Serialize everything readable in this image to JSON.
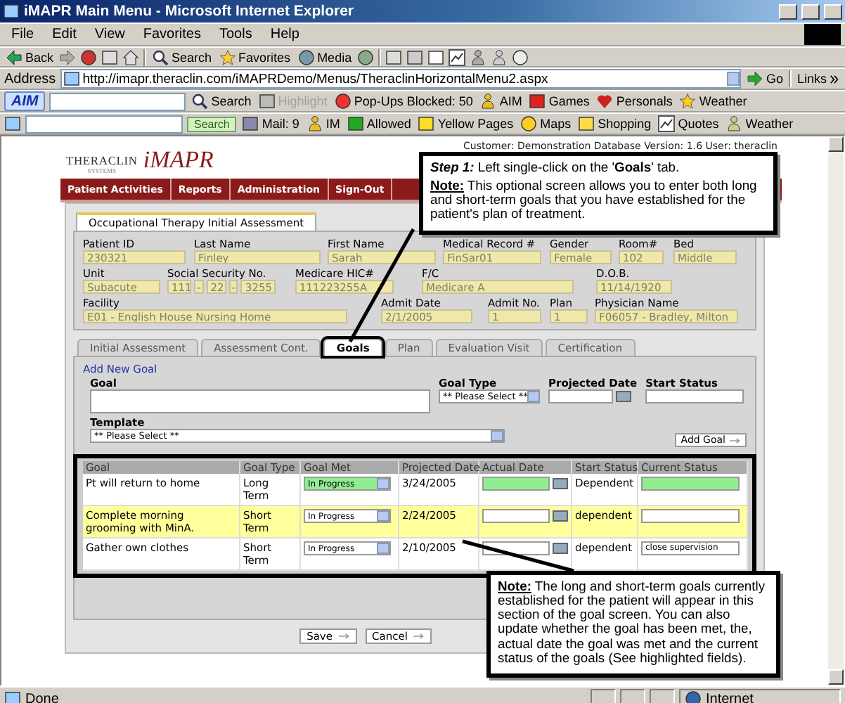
{
  "window": {
    "title": "iMAPR Main Menu - Microsoft Internet Explorer"
  },
  "menu": [
    "File",
    "Edit",
    "View",
    "Favorites",
    "Tools",
    "Help"
  ],
  "toolbar": [
    "Back",
    "Search",
    "Favorites",
    "Media"
  ],
  "address": {
    "label": "Address",
    "url": "http://imapr.theraclin.com/iMAPRDemo/Menus/TheraclinHorizontalMenu2.aspx",
    "go": "Go",
    "links": "Links"
  },
  "aim_bar": {
    "logo": "AIM",
    "items": [
      {
        "label": "Search",
        "disabled": false
      },
      {
        "label": "Highlight",
        "disabled": true
      },
      {
        "label": "Pop-Ups Blocked: 50",
        "disabled": false
      },
      {
        "label": "AIM",
        "disabled": false
      },
      {
        "label": "Games",
        "disabled": false
      },
      {
        "label": "Personals",
        "disabled": false
      },
      {
        "label": "Weather",
        "disabled": false
      }
    ]
  },
  "search_bar": {
    "button": "Search",
    "items": [
      "Mail: 9",
      "IM",
      "Allowed",
      "Yellow Pages",
      "Maps",
      "Shopping",
      "Quotes",
      "Weather"
    ]
  },
  "customer_info": "Customer: Demonstration Database Version: 1.6 User: theraclin",
  "logo": {
    "company": "THERACLIN",
    "sub": "SYSTEMS",
    "product": "iMAPR"
  },
  "nav": [
    "Patient Activities",
    "Reports",
    "Administration",
    "Sign-Out"
  ],
  "form_tab": "Occupational Therapy Initial Assessment",
  "fields": [
    [
      {
        "kind": "text",
        "label": "Patient ID",
        "value": "230321"
      },
      {
        "kind": "text",
        "label": "Last Name",
        "value": "Finley"
      },
      {
        "kind": "text",
        "label": "First Name",
        "value": "Sarah"
      },
      {
        "kind": "text",
        "label": "Medical Record #",
        "value": "FinSar01"
      },
      {
        "kind": "text",
        "label": "Gender",
        "value": "Female"
      },
      {
        "kind": "text",
        "label": "Room#",
        "value": "102"
      },
      {
        "kind": "text",
        "label": "Bed",
        "value": "Middle"
      }
    ],
    [
      {
        "kind": "text",
        "label": "Unit",
        "value": "Subacute"
      },
      {
        "kind": "split",
        "label": "Social Security No.",
        "parts": [
          "111",
          "22",
          "3255"
        ],
        "separator": "-"
      },
      {
        "kind": "text",
        "label": "Medicare HIC#",
        "value": "111223255A"
      },
      {
        "kind": "text",
        "label": "F/C",
        "value": "Medicare A"
      },
      {
        "kind": "text",
        "label": "D.O.B.",
        "value": "11/14/1920"
      }
    ],
    [
      {
        "kind": "text",
        "label": "Facility",
        "value": "E01 - English House Nursing Home"
      },
      {
        "kind": "text",
        "label": "Admit Date",
        "value": "2/1/2005"
      },
      {
        "kind": "text",
        "label": "Admit No.",
        "value": "1"
      },
      {
        "kind": "text",
        "label": "Plan",
        "value": "1"
      },
      {
        "kind": "text",
        "label": "Physician Name",
        "value": "F06057 - Bradley, Milton"
      }
    ]
  ],
  "tabs": [
    {
      "label": "Initial Assessment",
      "selected": false
    },
    {
      "label": "Assessment Cont.",
      "selected": false
    },
    {
      "label": "Goals",
      "selected": true
    },
    {
      "label": "Plan",
      "selected": false
    },
    {
      "label": "Evaluation Visit",
      "selected": false
    },
    {
      "label": "Certification",
      "selected": false
    }
  ],
  "add_goal": {
    "legend": "Add New Goal",
    "goal_label": "Goal",
    "goal_type_label": "Goal Type",
    "goal_type_value": "** Please Select **",
    "projected_date_label": "Projected Date",
    "start_status_label": "Start Status",
    "template_label": "Template",
    "template_value": "** Please Select **",
    "add_button": "Add Goal"
  },
  "goals_table": {
    "columns": [
      "Goal",
      "Goal Type",
      "Goal Met",
      "Projected Date",
      "Actual Date",
      "Start Status",
      "Current Status"
    ],
    "rows": [
      {
        "goal": "Pt will return to home",
        "goal_type": "Long Term",
        "goal_met": "In Progress",
        "projected_date": "3/24/2005",
        "start_status": "Dependent",
        "highlighted": true,
        "selected": false
      },
      {
        "goal": "Complete morning grooming with MinA.",
        "goal_type": "Short Term",
        "goal_met": "In Progress",
        "projected_date": "2/24/2005",
        "start_status": "dependent",
        "highlighted": false,
        "selected": true
      },
      {
        "goal": "Gather own clothes",
        "goal_type": "Short Term",
        "goal_met": "In Progress",
        "projected_date": "2/10/2005",
        "start_status": "dependent",
        "current_status": "close supervision",
        "highlighted": false,
        "selected": false
      }
    ]
  },
  "buttons": [
    "Save",
    "Cancel"
  ],
  "callouts": [
    {
      "paragraphs": [
        "**Step 1:** Left single-click on the '**Goals**' tab.",
        "**Note:** This optional screen allows you to enter both long and short-term goals that you have established for the patient's plan of treatment."
      ]
    },
    {
      "paragraphs": [
        "**Note:** The long and short-term goals currently established for the patient will appear in this section of the goal screen. You can also update whether the goal has been met, the, actual date the goal was met and the current status of the goals (See highlighted fields)."
      ]
    }
  ],
  "status_bar": {
    "text": "Done",
    "zone": "Internet"
  }
}
